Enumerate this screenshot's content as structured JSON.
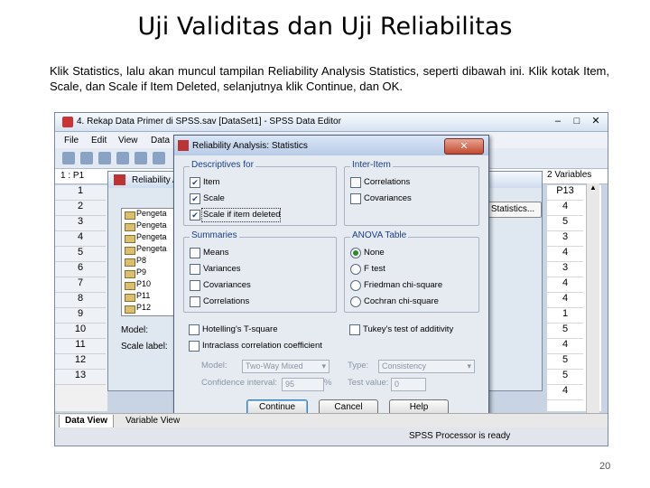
{
  "slide": {
    "title": "Uji Validitas dan Uji Reliabilitas",
    "body": "Klik Statistics, lalu akan muncul tampilan Reliability Analysis Statistics, seperti dibawah ini. Klik kotak Item, Scale, dan Scale if Item Deleted, selanjutnya klik Continue, dan OK.",
    "page_number": "20"
  },
  "editor": {
    "title": "4. Rekap Data Primer di SPSS.sav [DataSet1] - SPSS Data Editor",
    "menu": [
      "File",
      "Edit",
      "View",
      "Data"
    ],
    "cell_ref": "1 : P1",
    "variables_count": "2 Variables",
    "col_header": "P13",
    "row_numbers": [
      "1",
      "2",
      "3",
      "4",
      "5",
      "6",
      "7",
      "8",
      "9",
      "10",
      "11",
      "12",
      "13"
    ],
    "right_values": [
      "4",
      "5",
      "3",
      "4",
      "3",
      "4",
      "4",
      "1",
      "5",
      "4",
      "5",
      "5",
      "4"
    ],
    "tabs": {
      "data_view": "Data View",
      "variable_view": "Variable View"
    },
    "status": "SPSS Processor is ready",
    "window_buttons": [
      "–",
      "□",
      "✕"
    ]
  },
  "reliability": {
    "title": "Reliability Analysis",
    "items": [
      "Pengeta",
      "Pengeta",
      "Pengeta",
      "Pengeta",
      "P8",
      "P9",
      "P10",
      "P11",
      "P12"
    ],
    "model_label": "Model:",
    "scale_label": "Scale label:",
    "statistics_button": "Statistics..."
  },
  "dialog": {
    "title": "Reliability Analysis: Statistics",
    "close": "✕",
    "descriptives": {
      "title": "Descriptives for",
      "options": [
        {
          "label": "Item",
          "checked": true
        },
        {
          "label": "Scale",
          "checked": true
        },
        {
          "label": "Scale if item deleted",
          "checked": true
        }
      ]
    },
    "inter_item": {
      "title": "Inter-Item",
      "options": [
        {
          "label": "Correlations",
          "checked": false
        },
        {
          "label": "Covariances",
          "checked": false
        }
      ]
    },
    "summaries": {
      "title": "Summaries",
      "options": [
        {
          "label": "Means",
          "checked": false
        },
        {
          "label": "Variances",
          "checked": false
        },
        {
          "label": "Covariances",
          "checked": false
        },
        {
          "label": "Correlations",
          "checked": false
        }
      ]
    },
    "anova": {
      "title": "ANOVA Table",
      "options": [
        {
          "label": "None",
          "selected": true
        },
        {
          "label": "F test",
          "selected": false
        },
        {
          "label": "Friedman chi-square",
          "selected": false
        },
        {
          "label": "Cochran chi-square",
          "selected": false
        }
      ]
    },
    "hotelling": "Hotelling's T-square",
    "tukey": "Tukey's test of additivity",
    "intraclass": "Intraclass correlation coefficient",
    "model_label": "Model:",
    "model_value": "Two-Way Mixed",
    "type_label": "Type:",
    "type_value": "Consistency",
    "ci_label": "Confidence interval:",
    "ci_value": "95",
    "ci_unit": "%",
    "test_label": "Test value:",
    "test_value": "0",
    "buttons": {
      "continue": "Continue",
      "cancel": "Cancel",
      "help": "Help"
    }
  }
}
